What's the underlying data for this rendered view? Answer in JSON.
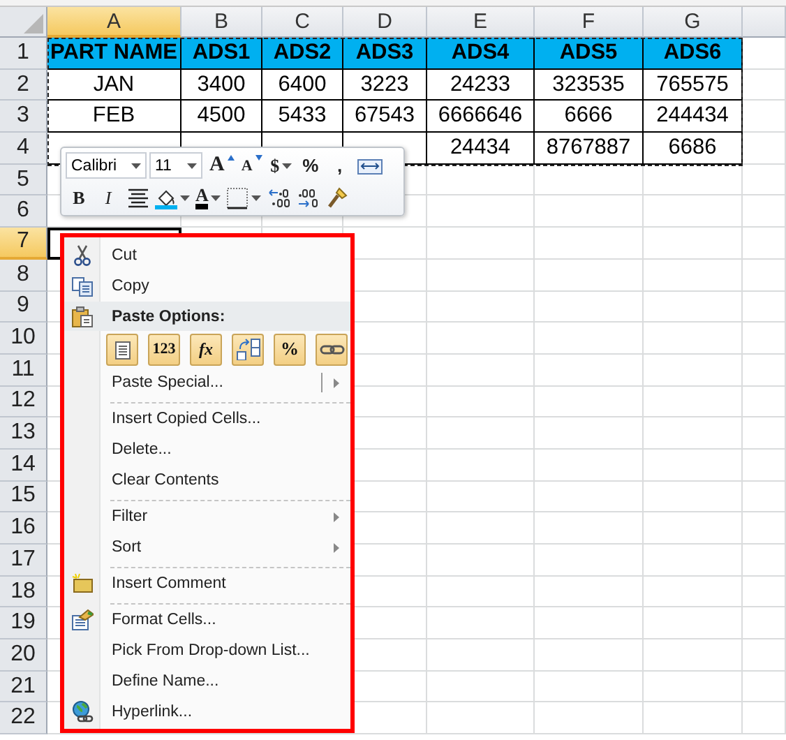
{
  "sheet": {
    "copy_marquee": true
  },
  "columns": [
    {
      "label": "A",
      "selected": true
    },
    {
      "label": "B",
      "selected": false
    },
    {
      "label": "C",
      "selected": false
    },
    {
      "label": "D",
      "selected": false
    },
    {
      "label": "E",
      "selected": false
    },
    {
      "label": "F",
      "selected": false
    },
    {
      "label": "G",
      "selected": false
    }
  ],
  "rows": [
    {
      "number": "1",
      "selected": false,
      "kind": "header",
      "cells": [
        "PART NAME",
        "ADS1",
        "ADS2",
        "ADS3",
        "ADS4",
        "ADS5",
        "ADS6"
      ]
    },
    {
      "number": "2",
      "selected": false,
      "kind": "data",
      "cells": [
        "JAN",
        "3400",
        "6400",
        "3223",
        "24233",
        "323535",
        "765575"
      ]
    },
    {
      "number": "3",
      "selected": false,
      "kind": "data",
      "cells": [
        "FEB",
        "4500",
        "5433",
        "67543",
        "6666646",
        "6666",
        "244434"
      ]
    },
    {
      "number": "4",
      "selected": false,
      "kind": "data",
      "cells": [
        null,
        null,
        null,
        null,
        "24434",
        "8767887",
        "6686"
      ]
    },
    {
      "number": "5",
      "selected": false,
      "kind": "empty"
    },
    {
      "number": "6",
      "selected": false,
      "kind": "empty"
    },
    {
      "number": "7",
      "selected": true,
      "kind": "empty"
    },
    {
      "number": "8",
      "selected": false,
      "kind": "empty"
    },
    {
      "number": "9",
      "selected": false,
      "kind": "empty"
    },
    {
      "number": "10",
      "selected": false,
      "kind": "empty"
    },
    {
      "number": "11",
      "selected": false,
      "kind": "empty"
    },
    {
      "number": "12",
      "selected": false,
      "kind": "empty"
    },
    {
      "number": "13",
      "selected": false,
      "kind": "empty"
    },
    {
      "number": "14",
      "selected": false,
      "kind": "empty"
    },
    {
      "number": "15",
      "selected": false,
      "kind": "empty"
    },
    {
      "number": "16",
      "selected": false,
      "kind": "empty"
    },
    {
      "number": "17",
      "selected": false,
      "kind": "empty"
    },
    {
      "number": "18",
      "selected": false,
      "kind": "empty"
    },
    {
      "number": "19",
      "selected": false,
      "kind": "empty"
    },
    {
      "number": "20",
      "selected": false,
      "kind": "empty"
    },
    {
      "number": "21",
      "selected": false,
      "kind": "empty"
    },
    {
      "number": "22",
      "selected": false,
      "kind": "empty"
    }
  ],
  "mini_toolbar": {
    "font": "Calibri",
    "size": "11",
    "row_1": [
      {
        "kind": "grow",
        "label": "A",
        "dropdown": false
      },
      {
        "kind": "shrink",
        "label": "A",
        "dropdown": false
      },
      {
        "kind": "currency",
        "label": "$",
        "dropdown": true
      },
      {
        "kind": "percent",
        "label": "%",
        "dropdown": false
      },
      {
        "kind": "comma",
        "label": ",",
        "dropdown": false
      },
      {
        "kind": "wrap",
        "dropdown": false
      }
    ],
    "row_2": [
      {
        "kind": "bold",
        "label": "B",
        "dropdown": false
      },
      {
        "kind": "italic",
        "label": "I",
        "dropdown": false
      },
      {
        "kind": "center",
        "dropdown": false
      },
      {
        "kind": "fill",
        "dropdown": true
      },
      {
        "kind": "fontcolor",
        "label": "A",
        "dropdown": true
      },
      {
        "kind": "borders",
        "dropdown": true
      },
      {
        "kind": "increase-decimal",
        "dropdown": false
      },
      {
        "kind": "decrease-decimal",
        "dropdown": false
      },
      {
        "kind": "painter",
        "dropdown": false
      }
    ]
  },
  "context_menu": {
    "items": [
      {
        "kind": "command",
        "label": "Cut",
        "submenu": false
      },
      {
        "kind": "command",
        "label": "Copy",
        "submenu": false
      },
      {
        "kind": "header",
        "label": "Paste Options:"
      },
      {
        "kind": "paste-buttons",
        "buttons": [
          {
            "kind": "page"
          },
          {
            "kind": "values",
            "label": "123"
          },
          {
            "kind": "formula",
            "label": "fx"
          },
          {
            "kind": "transpose"
          },
          {
            "kind": "formatting",
            "label": "%"
          },
          {
            "kind": "link"
          }
        ]
      },
      {
        "kind": "command",
        "label": "Paste Special...",
        "submenu": true
      },
      {
        "kind": "separator"
      },
      {
        "kind": "command",
        "label": "Insert Copied Cells...",
        "submenu": false
      },
      {
        "kind": "command",
        "label": "Delete...",
        "submenu": false
      },
      {
        "kind": "command",
        "label": "Clear Contents",
        "submenu": false
      },
      {
        "kind": "separator"
      },
      {
        "kind": "command",
        "label": "Filter",
        "submenu": true
      },
      {
        "kind": "command",
        "label": "Sort",
        "submenu": true
      },
      {
        "kind": "separator"
      },
      {
        "kind": "command",
        "label": "Insert Comment",
        "submenu": false
      },
      {
        "kind": "separator"
      },
      {
        "kind": "command",
        "label": "Format Cells...",
        "submenu": false
      },
      {
        "kind": "command",
        "label": "Pick From Drop-down List...",
        "submenu": false
      },
      {
        "kind": "command",
        "label": "Define Name...",
        "submenu": false
      },
      {
        "kind": "command",
        "label": "Hyperlink...",
        "submenu": false
      }
    ]
  }
}
